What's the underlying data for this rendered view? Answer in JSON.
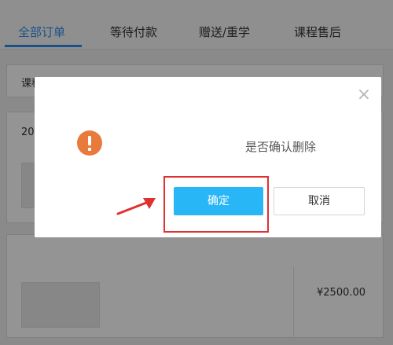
{
  "tabs": [
    {
      "label": "全部订单",
      "active": true
    },
    {
      "label": "等待付款",
      "active": false
    },
    {
      "label": "赠送/重学",
      "active": false
    },
    {
      "label": "课程售后",
      "active": false
    }
  ],
  "orders": {
    "header_left": "课程",
    "header_right": "",
    "order1_date": "20",
    "order2_date": "",
    "order2_number": "",
    "order2_course": "",
    "order2_price": "¥2500.00"
  },
  "dialog": {
    "message": "是否确认删除",
    "confirm_label": "确定",
    "cancel_label": "取消",
    "close_glyph": "×"
  },
  "colors": {
    "accent": "#2d8cf0",
    "confirm": "#29b6f6",
    "warning": "#e87a3c",
    "highlight": "#e03131"
  }
}
